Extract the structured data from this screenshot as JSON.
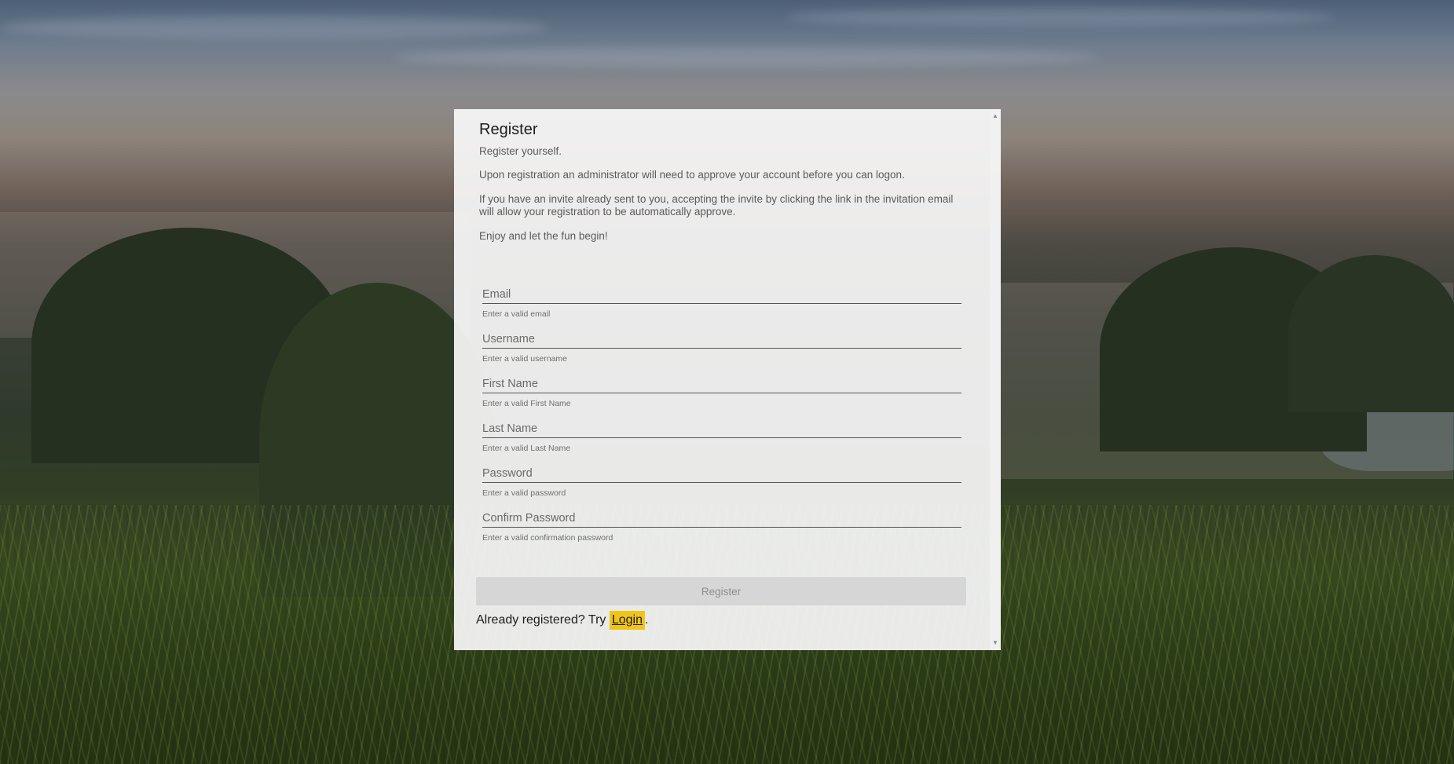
{
  "modal": {
    "title": "Register",
    "subtitle": "Register yourself.",
    "paragraphs": [
      "Upon registration an administrator will need to approve your account before you can logon.",
      "If you have an invite already sent to you, accepting the invite by clicking the link in the invitation email will allow your registration to be automatically approve.",
      "Enjoy and let the fun begin!"
    ]
  },
  "form": {
    "fields": [
      {
        "placeholder": "Email",
        "hint": "Enter a valid email"
      },
      {
        "placeholder": "Username",
        "hint": "Enter a valid username"
      },
      {
        "placeholder": "First Name",
        "hint": "Enter a valid First Name"
      },
      {
        "placeholder": "Last Name",
        "hint": "Enter a valid Last Name"
      },
      {
        "placeholder": "Password",
        "hint": "Enter a valid password"
      },
      {
        "placeholder": "Confirm Password",
        "hint": "Enter a valid confirmation password"
      }
    ],
    "submit_label": "Register"
  },
  "footer": {
    "already_text": "Already registered? Try ",
    "login_label": "Login",
    "trailing": "."
  },
  "colors": {
    "login_highlight": "#f0c419",
    "button_disabled_bg": "#d6d6d6",
    "button_disabled_text": "#8e8e8e"
  }
}
